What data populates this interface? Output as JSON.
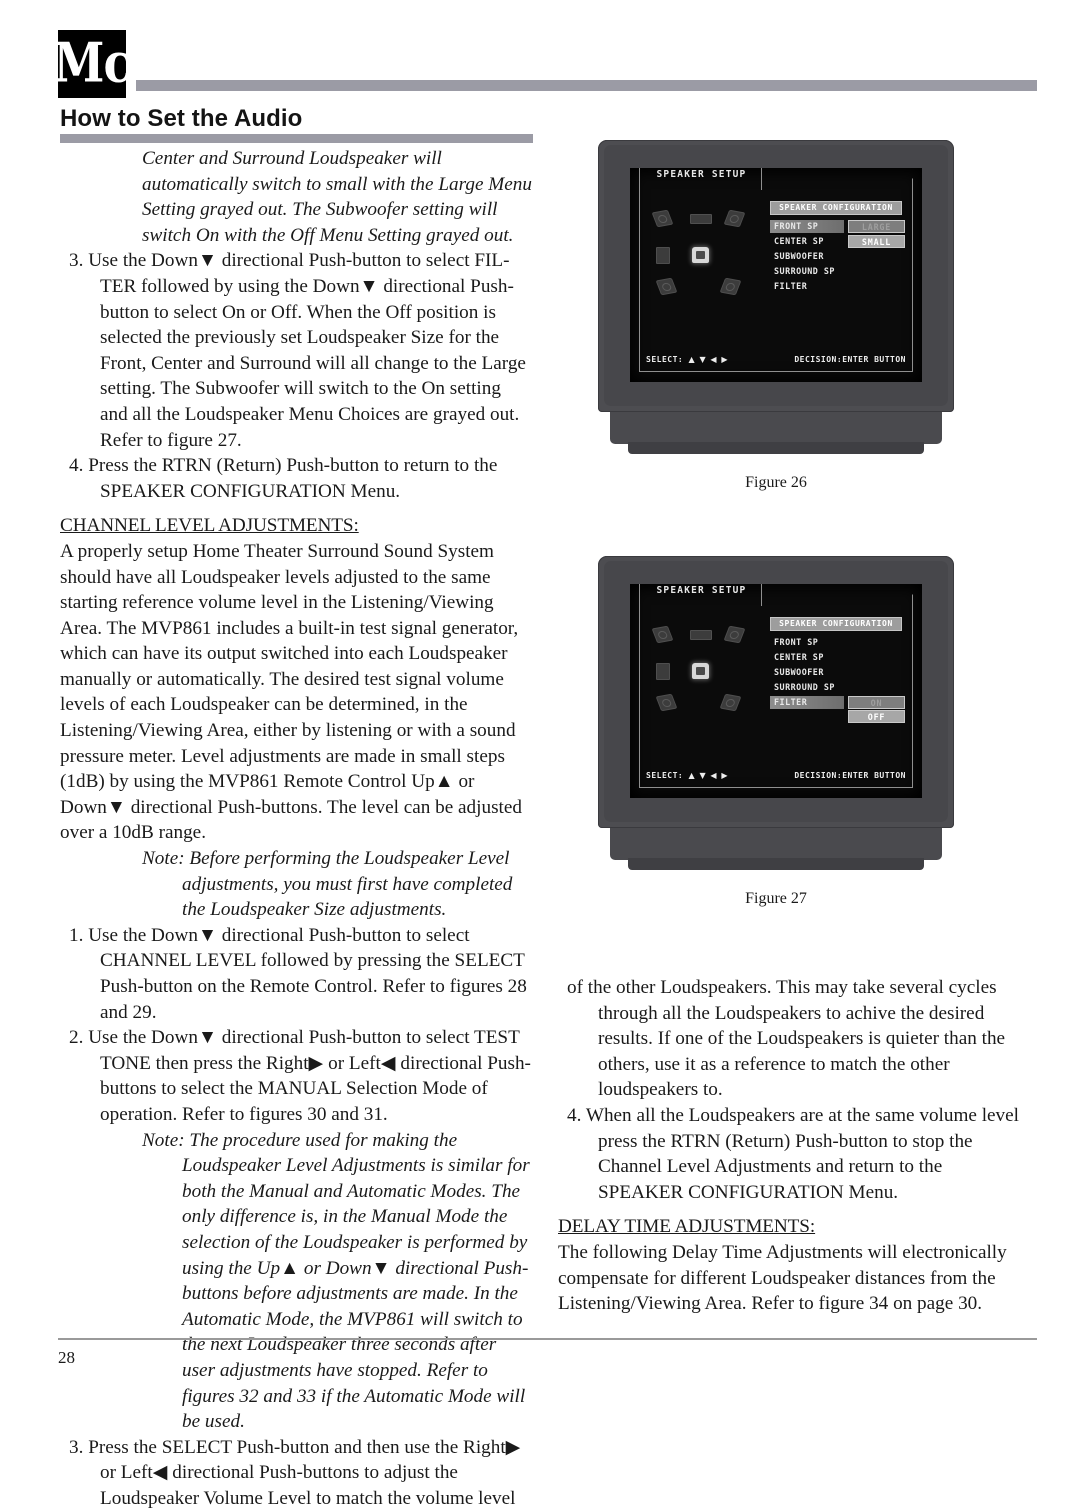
{
  "header": {
    "logo_text": "Mc",
    "title": "How to Set the Audio"
  },
  "left_column": {
    "note_intro": "Center and Surround Loudspeaker will automatically switch to small with the Large Menu Setting grayed out. The Subwoofer setting will switch On with the Off Menu Setting grayed out.",
    "step_3": "3. Use the Down▼ directional Push-button to select FIL-TER followed by using the Down▼ directional Push-button to select On or Off. When the Off position is selected the previously set Loudspeaker Size for the Front, Center and Surround will all change to the Large setting. The Subwoofer will switch to the On setting and all the Loudspeaker Menu Choices are grayed out. Refer to figure 27.",
    "step_4": "4. Press the RTRN (Return) Push-button to return to the SPEAKER CONFIGURATION Menu.",
    "section_heading": "CHANNEL LEVEL ADJUSTMENTS:",
    "body_paragraph": "A properly setup Home Theater Surround Sound System should have all Loudspeaker levels adjusted to the same starting reference volume level in the Listening/Viewing Area. The MVP861 includes a built-in test signal generator, which can have its output switched into each Loudspeaker manually or automatically. The desired test signal volume levels of each Loudspeaker can be determined, in the Listening/Viewing Area, either by listening or with a sound pressure meter. Level adjustments are made in small steps (1dB) by using the MVP861 Remote Control Up▲ or Down▼ directional Push-buttons. The level can be adjusted over a 10dB range.",
    "note_1": "Note: Before performing the Loudspeaker Level adjustments, you must first have completed the Loudspeaker Size adjustments.",
    "step_1": "1. Use the Down▼ directional Push-button to select CHANNEL LEVEL followed by pressing the SELECT Push-button on the Remote Control. Refer to figures 28 and 29.",
    "step_2": "2. Use the Down▼ directional Push-button to select TEST TONE then press the Right▶ or Left◀ directional Push-buttons to select the MANUAL Selection Mode of operation. Refer to figures 30 and 31.",
    "note_2": "Note: The procedure used for making the Loudspeaker Level Adjustments is similar for both the Manual and Automatic Modes. The only difference is, in the Manual Mode the selection of the Loudspeaker is performed by using the Up▲ or Down▼ directional Push-buttons before adjustments are made.  In the Automatic Mode, the MVP861 will switch to the next Loudspeaker three seconds after user adjustments have stopped. Refer to figures 32 and 33 if the Automatic Mode will be used.",
    "step_3b": "3. Press the SELECT Push-button and then use the Right▶ or Left◀ directional Push-buttons to adjust the Loudspeaker Volume Level to match the volume level"
  },
  "right_column": {
    "continuation": "of the other Loudspeakers. This may take several cycles through all the Loudspeakers to achive the desired results. If one of the Loudspeakers is quieter than the others, use it as a reference to match the other loudspeakers to.",
    "step_4": "4. When all the Loudspeakers are at the same volume level press the RTRN (Return) Push-button to stop the Channel Level Adjustments and return to the SPEAKER CONFIGURATION Menu.",
    "section_heading": "DELAY TIME ADJUSTMENTS:",
    "body_paragraph": "The following Delay Time Adjustments will electronically compensate for different Loudspeaker distances from the Listening/Viewing Area. Refer to figure 34 on page 30."
  },
  "figure_26": {
    "caption": "Figure 26",
    "osd": {
      "tab_title": "SPEAKER SETUP",
      "menu_header": "SPEAKER CONFIGURATION",
      "rows": [
        {
          "label": "FRONT SP",
          "selected": true
        },
        {
          "label": "CENTER SP",
          "selected": false
        },
        {
          "label": "SUBWOOFER",
          "selected": false
        },
        {
          "label": "SURROUND SP",
          "selected": false
        },
        {
          "label": "FILTER",
          "selected": false
        }
      ],
      "options": [
        {
          "label": "LARGE",
          "state": "dim"
        },
        {
          "label": "SMALL",
          "state": "bright"
        }
      ],
      "footer_select": "SELECT:",
      "footer_arrows": "▲ ▼ ◀ ▶",
      "footer_decision": "DECISION:ENTER BUTTON"
    }
  },
  "figure_27": {
    "caption": "Figure 27",
    "osd": {
      "tab_title": "SPEAKER SETUP",
      "menu_header": "SPEAKER CONFIGURATION",
      "rows": [
        {
          "label": "FRONT SP",
          "selected": false
        },
        {
          "label": "CENTER SP",
          "selected": false
        },
        {
          "label": "SUBWOOFER",
          "selected": false
        },
        {
          "label": "SURROUND SP",
          "selected": false
        },
        {
          "label": "FILTER",
          "selected": true
        }
      ],
      "options": [
        {
          "label": "ON",
          "state": "dim"
        },
        {
          "label": "OFF",
          "state": "bright"
        }
      ],
      "footer_select": "SELECT:",
      "footer_arrows": "▲ ▼ ◀ ▶",
      "footer_decision": "DECISION:ENTER BUTTON"
    }
  },
  "footer": {
    "page_number": "28"
  },
  "colors": {
    "rule_gray": "#9b9ba5",
    "logo_bg": "#000000",
    "tv_bezel": "#4d4d51",
    "screen_bg": "#0b0b0b",
    "osd_border": "#8f8f8f"
  }
}
